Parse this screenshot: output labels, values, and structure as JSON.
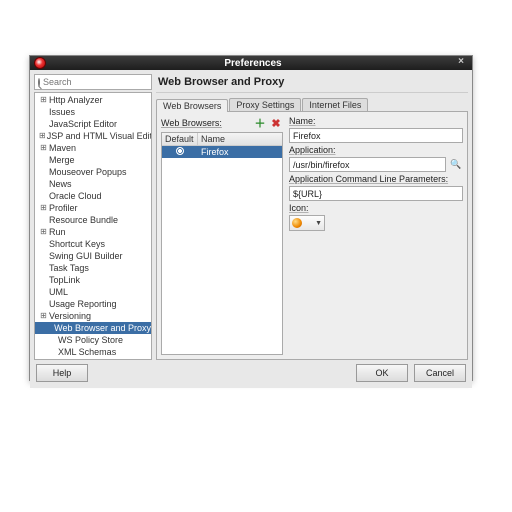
{
  "window": {
    "title": "Preferences"
  },
  "search": {
    "placeholder": "Search"
  },
  "tree": [
    {
      "label": "Http Analyzer",
      "expandable": true
    },
    {
      "label": "Issues"
    },
    {
      "label": "JavaScript Editor"
    },
    {
      "label": "JSP and HTML Visual Edit",
      "expandable": true
    },
    {
      "label": "Maven",
      "expandable": true
    },
    {
      "label": "Merge"
    },
    {
      "label": "Mouseover Popups"
    },
    {
      "label": "News"
    },
    {
      "label": "Oracle Cloud"
    },
    {
      "label": "Profiler",
      "expandable": true
    },
    {
      "label": "Resource Bundle"
    },
    {
      "label": "Run",
      "expandable": true
    },
    {
      "label": "Shortcut Keys"
    },
    {
      "label": "Swing GUI Builder"
    },
    {
      "label": "Task Tags"
    },
    {
      "label": "TopLink"
    },
    {
      "label": "UML"
    },
    {
      "label": "Usage Reporting"
    },
    {
      "label": "Versioning",
      "expandable": true
    },
    {
      "label": "Web Browser and Proxy",
      "selected": true,
      "child": true
    },
    {
      "label": "WS Policy Store",
      "child": true
    },
    {
      "label": "XML Schemas",
      "child": true
    }
  ],
  "main": {
    "title": "Web Browser and Proxy",
    "tabs": [
      {
        "label": "Web Browsers",
        "active": true
      },
      {
        "label": "Proxy Settings"
      },
      {
        "label": "Internet Files"
      }
    ],
    "browsersLabel": "Web Browsers:",
    "columns": {
      "c1": "Default",
      "c2": "Name"
    },
    "rows": [
      {
        "default": true,
        "name": "Firefox"
      }
    ],
    "fields": {
      "nameLabel": "Name:",
      "nameValue": "Firefox",
      "appLabel": "Application:",
      "appValue": "/usr/bin/firefox",
      "paramsLabel": "Application Command Line Parameters:",
      "paramsValue": "${URL}",
      "iconLabel": "Icon:"
    }
  },
  "buttons": {
    "help": "Help",
    "ok": "OK",
    "cancel": "Cancel"
  }
}
